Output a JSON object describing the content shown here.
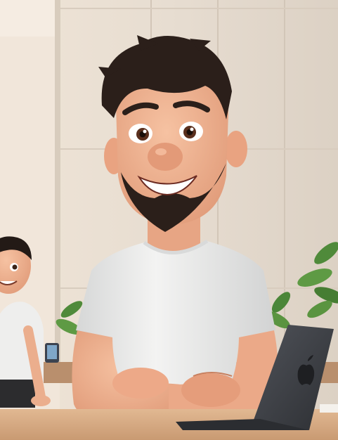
{
  "scene": {
    "description_colors": {
      "wall": "#e8e0d5",
      "wall_shadow": "#d8cbbb",
      "panel_line": "#cfc3b4",
      "skin": "#f0b493",
      "skin_shadow": "#d98e70",
      "hair": "#2b1f1a",
      "shirt": "#efefee",
      "shirt_shadow": "#cfd0d0",
      "laptop": "#3b3d42",
      "desk": "#d7ad86",
      "plant": "#4f8a3a"
    },
    "icons": [
      "person-icon",
      "laptop-icon",
      "plant-icon",
      "apple-logo-icon"
    ]
  }
}
